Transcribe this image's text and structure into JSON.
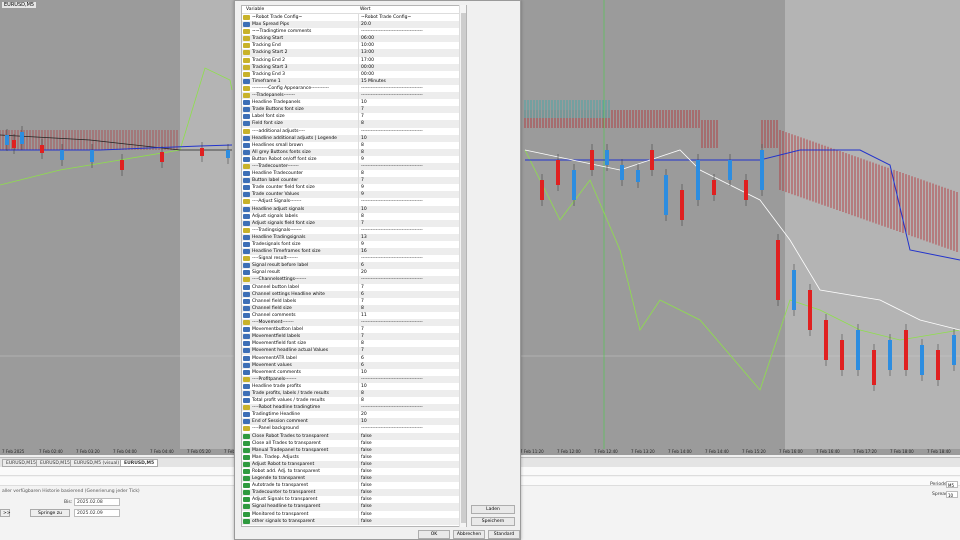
{
  "chart": {
    "symbol": "EURUSD,M5",
    "time_labels": [
      "7 Feb 2025",
      "7 Feb 02:40",
      "7 Feb 03:20",
      "7 Feb 04:00",
      "7 Feb 04:40",
      "7 Feb 05:20",
      "7 Feb 06:00",
      "7 Feb 06:40",
      "7 Feb 07:20",
      "7 Feb 08:00",
      "7 Feb 08:40",
      "7 Feb 09:20",
      "7 Feb 10:00",
      "7 Feb 10:40",
      "7 Feb 11:20",
      "7 Feb 12:00",
      "7 Feb 12:40",
      "7 Feb 13:20",
      "7 Feb 14:00",
      "7 Feb 14:40",
      "7 Feb 15:20",
      "7 Feb 16:00",
      "7 Feb 16:40",
      "7 Feb 17:20",
      "7 Feb 18:00",
      "7 Feb 18:40"
    ]
  },
  "tabs": [
    "EURUSD,M15",
    "EURUSD,M15",
    "EURUSD,M5 (visual)",
    "EURUSD,M5"
  ],
  "bottom": {
    "hint": "aller verfügbaren Historie basierend (Generierung jeder Tick)",
    "bis_label": "Bis:",
    "bis_value": "2025.02.08",
    "from_value": "2025.02.09",
    "skip_button": "Springe zu",
    "nav_button": ">>",
    "periode_label": "Periode:",
    "periode_value": "M5",
    "spread_label": "Spread:",
    "spread_value": "10"
  },
  "dialog": {
    "col_variable": "Variable",
    "col_value": "Wert",
    "buttons": {
      "load": "Laden",
      "save": "Speichern",
      "ok": "OK",
      "cancel": "Abbrechen",
      "reset": "Standard"
    },
    "rows": [
      {
        "icon": "ab",
        "name": "~Robot Trade Config~",
        "value": "~Robot Trade Config~"
      },
      {
        "icon": "int",
        "name": "Max Spread Pips",
        "value": "20.0"
      },
      {
        "icon": "ab",
        "name": "~~Tradingtime comments",
        "value": "--------------------------------------"
      },
      {
        "icon": "ab",
        "name": "Tracking Start",
        "value": "06:00"
      },
      {
        "icon": "ab",
        "name": "Tracking End",
        "value": "10:00"
      },
      {
        "icon": "ab",
        "name": "Tracking Start 2",
        "value": "13:00"
      },
      {
        "icon": "ab",
        "name": "Tracking End 2",
        "value": "17:00"
      },
      {
        "icon": "ab",
        "name": "Tracking Start 3",
        "value": "00:00"
      },
      {
        "icon": "ab",
        "name": "Tracking End 3",
        "value": "00:00"
      },
      {
        "icon": "int",
        "name": "Timeframe 1",
        "value": "15 Minutes"
      },
      {
        "icon": "ab",
        "name": "----------Config Appearance-----------",
        "value": "--------------------------------------"
      },
      {
        "icon": "ab",
        "name": "---Tradepanels-------",
        "value": "--------------------------------------"
      },
      {
        "icon": "int",
        "name": "Headline Tradepanels",
        "value": "10"
      },
      {
        "icon": "int",
        "name": "Trade Buttons font size",
        "value": "7"
      },
      {
        "icon": "int",
        "name": "Label font size",
        "value": "7"
      },
      {
        "icon": "int",
        "name": "Field font size",
        "value": "8"
      },
      {
        "icon": "ab",
        "name": "----additional adjusts----",
        "value": "--------------------------------------"
      },
      {
        "icon": "int",
        "name": "Headline additional adjusts | Legende",
        "value": "10"
      },
      {
        "icon": "int",
        "name": "Headlines small brown",
        "value": "8"
      },
      {
        "icon": "int",
        "name": "All grey Buttons fonts size",
        "value": "8"
      },
      {
        "icon": "int",
        "name": "Button Robot on/off font size",
        "value": "9"
      },
      {
        "icon": "ab",
        "name": "----Tradecounter-------",
        "value": "--------------------------------------"
      },
      {
        "icon": "int",
        "name": "Headline Tradecounter",
        "value": "8"
      },
      {
        "icon": "int",
        "name": "Button label counter",
        "value": "7"
      },
      {
        "icon": "int",
        "name": "Trade counter field font size",
        "value": "9"
      },
      {
        "icon": "int",
        "name": "Trade counter Values",
        "value": "9"
      },
      {
        "icon": "ab",
        "name": "----Adjust Signals-------",
        "value": "--------------------------------------"
      },
      {
        "icon": "int",
        "name": "Headline adjust signals",
        "value": "10"
      },
      {
        "icon": "int",
        "name": "Adjust signals labels",
        "value": "8"
      },
      {
        "icon": "int",
        "name": "Adjust signals field font size",
        "value": "7"
      },
      {
        "icon": "ab",
        "name": "----Tradingsignals-------",
        "value": "--------------------------------------"
      },
      {
        "icon": "int",
        "name": "Headline Tradingsignals",
        "value": "13"
      },
      {
        "icon": "int",
        "name": "Tradesignals font size",
        "value": "9"
      },
      {
        "icon": "int",
        "name": "Headline Timeframes font size",
        "value": "16"
      },
      {
        "icon": "ab",
        "name": "----Signal result-------",
        "value": "--------------------------------------"
      },
      {
        "icon": "int",
        "name": "Signal result before label",
        "value": "6"
      },
      {
        "icon": "int",
        "name": "Signal result",
        "value": "20"
      },
      {
        "icon": "ab",
        "name": "----Channelsettings-------",
        "value": "--------------------------------------"
      },
      {
        "icon": "int",
        "name": "Channel button label",
        "value": "7"
      },
      {
        "icon": "int",
        "name": "Channel settings Headline white",
        "value": "6"
      },
      {
        "icon": "int",
        "name": "Channel field labels",
        "value": "7"
      },
      {
        "icon": "int",
        "name": "Channel field size",
        "value": "8"
      },
      {
        "icon": "int",
        "name": "Channel comments",
        "value": "11"
      },
      {
        "icon": "ab",
        "name": "----Movement-------",
        "value": "--------------------------------------"
      },
      {
        "icon": "int",
        "name": "Movementbutton label",
        "value": "7"
      },
      {
        "icon": "int",
        "name": "Movementfield labels",
        "value": "7"
      },
      {
        "icon": "int",
        "name": "Movementfield font size",
        "value": "8"
      },
      {
        "icon": "int",
        "name": "Movement headline actual Values",
        "value": "7"
      },
      {
        "icon": "int",
        "name": "MovementATR label",
        "value": "6"
      },
      {
        "icon": "int",
        "name": "Movement values",
        "value": "6"
      },
      {
        "icon": "int",
        "name": "Movement comments",
        "value": "10"
      },
      {
        "icon": "ab",
        "name": "----Profitpanels-------",
        "value": "--------------------------------------"
      },
      {
        "icon": "int",
        "name": "Headline trade profits",
        "value": "10"
      },
      {
        "icon": "int",
        "name": "Trade profits, labels / trade results",
        "value": "8"
      },
      {
        "icon": "int",
        "name": "Total profit values / trade results",
        "value": "8"
      },
      {
        "icon": "ab",
        "name": "----Robot headline tradingtime",
        "value": "--------------------------------------"
      },
      {
        "icon": "int",
        "name": "Tradingtime Headline",
        "value": "20"
      },
      {
        "icon": "int",
        "name": "End of Session comment",
        "value": "10"
      },
      {
        "icon": "ab",
        "name": "----Panel background",
        "value": "--------------------------------------"
      },
      {
        "icon": "bool",
        "name": "Close Robot Trades to transparent",
        "value": "false"
      },
      {
        "icon": "bool",
        "name": "Close all Trades to transparent",
        "value": "false"
      },
      {
        "icon": "bool",
        "name": "Manual Tradepanel to transparent",
        "value": "false"
      },
      {
        "icon": "bool",
        "name": "Man. Tradep. Adjusts",
        "value": "false"
      },
      {
        "icon": "bool",
        "name": "Adjust Robot to transparent",
        "value": "false"
      },
      {
        "icon": "bool",
        "name": "Robot add. Adj. to transparent",
        "value": "false"
      },
      {
        "icon": "bool",
        "name": "Legende to transparent",
        "value": "false"
      },
      {
        "icon": "bool",
        "name": "Autotrade to transparent",
        "value": "false"
      },
      {
        "icon": "bool",
        "name": "Tradecounter to transparent",
        "value": "false"
      },
      {
        "icon": "bool",
        "name": "Adjust Signals to transparent",
        "value": "false"
      },
      {
        "icon": "bool",
        "name": "Signal headline to transparent",
        "value": "false"
      },
      {
        "icon": "bool",
        "name": "Monitored to transparent",
        "value": "false"
      },
      {
        "icon": "bool",
        "name": "other signals to transparent",
        "value": "false"
      }
    ]
  }
}
